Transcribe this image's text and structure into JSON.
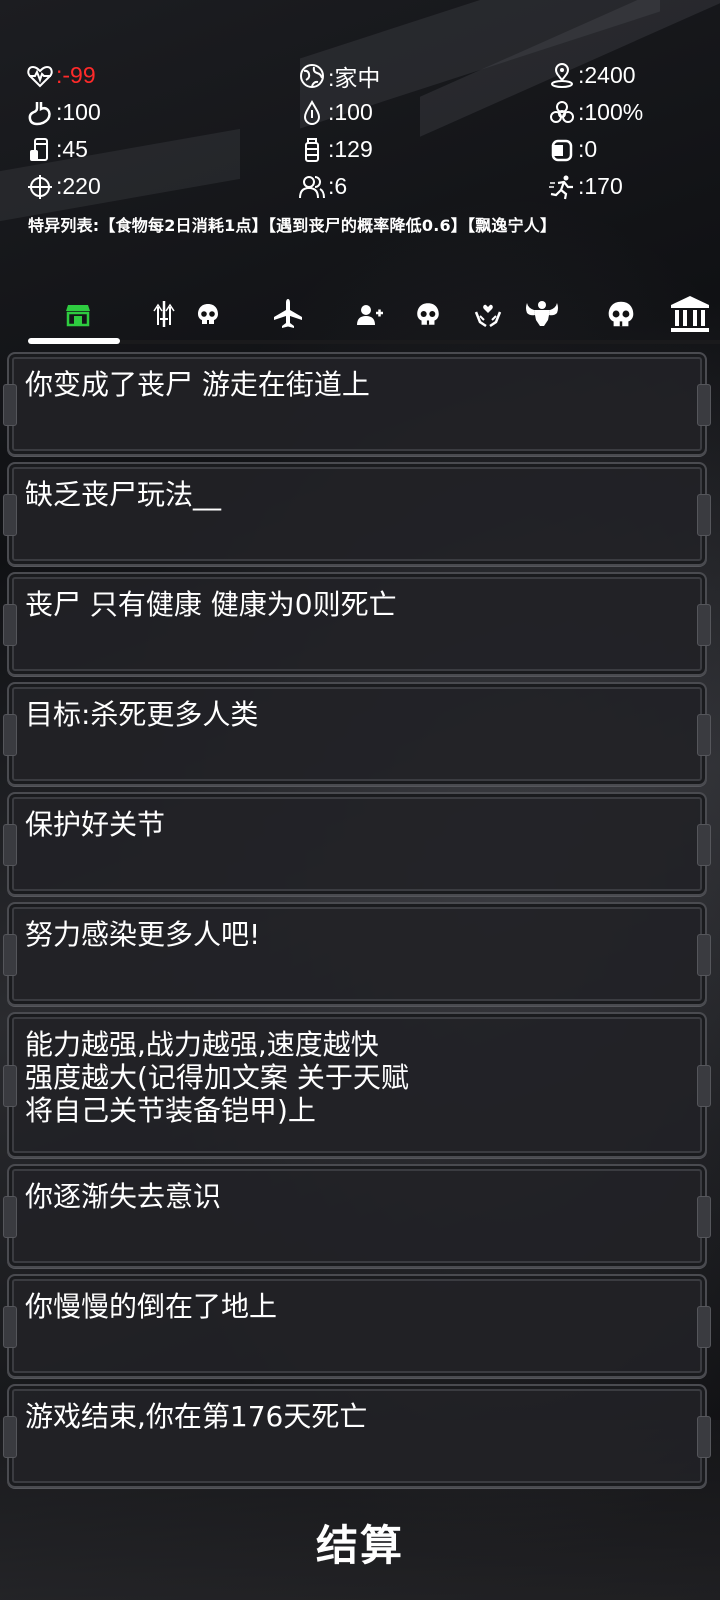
{
  "stats": {
    "health": ":-99",
    "location": ":家中",
    "distance": ":2400",
    "food": ":100",
    "water": ":100",
    "infection": ":100%",
    "drink": ":45",
    "medicine": ":129",
    "cans": ":0",
    "attack": ":220",
    "people": ":6",
    "speed": ":170"
  },
  "traits_line": "特异列表:【食物每2日消耗1点】【遇到丧尸的概率降低0.6】【飘逸宁人】",
  "tabs": [
    {
      "icon": "shop-icon",
      "active": true,
      "color": "#2ecc40"
    },
    {
      "icon": "weapons-icon",
      "active": false
    },
    {
      "icon": "skull-icon",
      "active": false
    },
    {
      "icon": "airplane-icon",
      "active": false
    },
    {
      "icon": "add-person-icon",
      "active": false
    },
    {
      "icon": "skull-icon",
      "active": false
    },
    {
      "icon": "hands-heart-icon",
      "active": false
    },
    {
      "icon": "muscle-icon",
      "active": false
    },
    {
      "icon": "skull-icon",
      "active": false
    },
    {
      "icon": "bank-icon",
      "active": false
    }
  ],
  "log": [
    "你变成了丧尸 游走在街道上",
    "缺乏丧尸玩法__",
    "丧尸 只有健康 健康为0则死亡",
    "目标:杀死更多人类",
    "保护好关节",
    "努力感染更多人吧!",
    "能力越强,战力越强,速度越快\n强度越大(记得加文案 关于天赋\n将自己关节装备铠甲)上",
    "你逐渐失去意识",
    "你慢慢的倒在了地上",
    "游戏结束,你在第176天死亡"
  ],
  "settle_label": "结算",
  "colors": {
    "danger": "#ff2a2a",
    "active_tab": "#2ecc40",
    "text": "#ffffff"
  }
}
